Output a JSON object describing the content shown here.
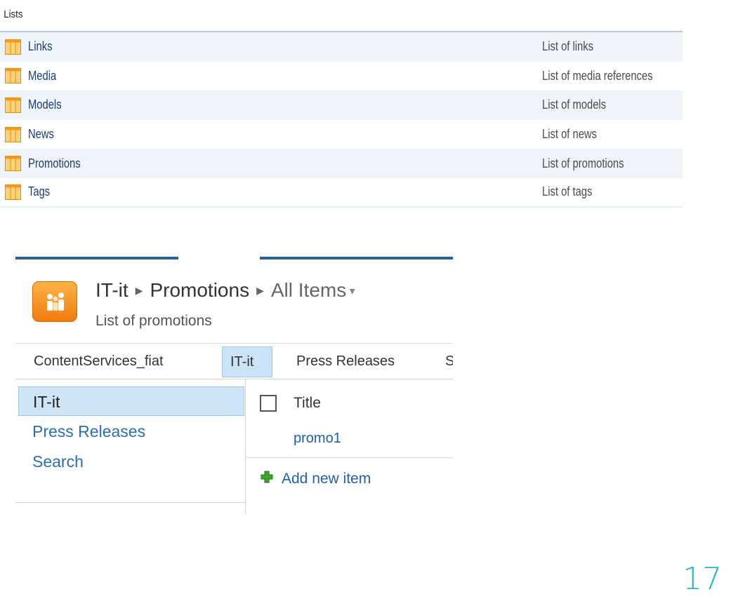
{
  "lists_panel": {
    "title": "Lists",
    "items": [
      {
        "name": "Links",
        "description": "List of links",
        "icon": "list-icon"
      },
      {
        "name": "Media",
        "description": "List of media references",
        "icon": "list-icon"
      },
      {
        "name": "Models",
        "description": "List of models",
        "icon": "list-icon"
      },
      {
        "name": "News",
        "description": "List of news",
        "icon": "list-icon"
      },
      {
        "name": "Promotions",
        "description": "List of promotions",
        "icon": "list-icon"
      },
      {
        "name": "Tags",
        "description": "List of tags",
        "icon": "list-icon"
      }
    ]
  },
  "sharepoint": {
    "breadcrumb": {
      "site": "IT-it",
      "list": "Promotions",
      "view": "All Items"
    },
    "subtitle": "List of promotions",
    "top_nav": [
      "ContentServices_fiat",
      "IT-it",
      "Press Releases",
      "S"
    ],
    "left_nav": [
      "IT-it",
      "Press Releases",
      "Search"
    ],
    "column_header": "Title",
    "items": [
      "promo1"
    ],
    "add_new_label": "Add new item"
  },
  "page_number": "17",
  "colors": {
    "accent": "#22b8c4",
    "link": "#1f5fb0",
    "icon_orange": "#f39a1e"
  }
}
